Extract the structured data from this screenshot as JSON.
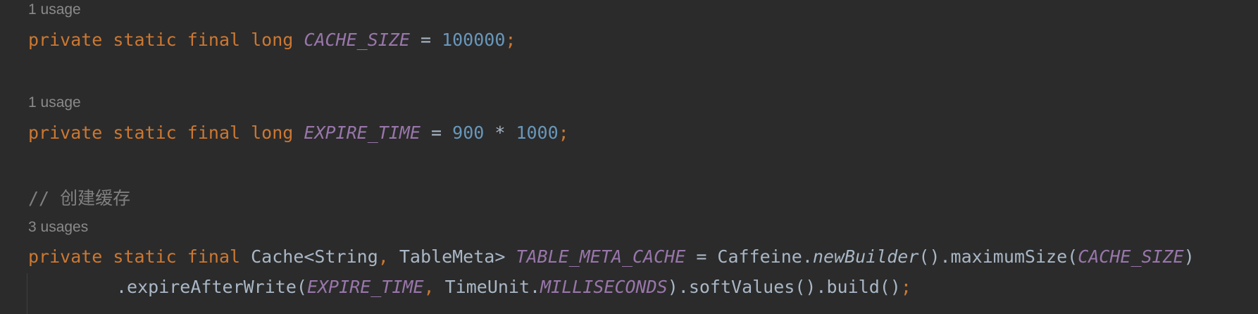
{
  "hints": [
    "1 usage",
    "1 usage",
    "3 usages"
  ],
  "comment": "// 创建缓存",
  "line1": {
    "kw_private": "private",
    "kw_static": "static",
    "kw_final": "final",
    "kw_long": "long",
    "name": "CACHE_SIZE",
    "eq": " = ",
    "value": "100000",
    "semi": ";"
  },
  "line2": {
    "kw_private": "private",
    "kw_static": "static",
    "kw_final": "final",
    "kw_long": "long",
    "name": "EXPIRE_TIME",
    "eq": " = ",
    "value1": "900",
    "op": " * ",
    "value2": "1000",
    "semi": ";"
  },
  "line3": {
    "kw_private": "private",
    "kw_static": "static",
    "kw_final": "final",
    "type": "Cache<String",
    "comma": ",",
    "type2": " TableMeta> ",
    "name": "TABLE_META_CACHE",
    "eq": " = Caffeine.",
    "method": "newBuilder",
    "rest": "().maximumSize(",
    "arg": "CACHE_SIZE",
    "close": ")"
  },
  "line4": {
    "start": ".expireAfterWrite(",
    "arg1": "EXPIRE_TIME",
    "comma": ",",
    "mid": " TimeUnit.",
    "arg2": "MILLISECONDS",
    "end": ").softValues().build()",
    "semi": ";"
  },
  "colors": {
    "background": "#2b2b2b",
    "keyword": "#cc7832",
    "constant": "#9876aa",
    "number": "#6897bb",
    "plain": "#a9b7c6",
    "hint": "#8a8a8a",
    "comment": "#808080"
  }
}
